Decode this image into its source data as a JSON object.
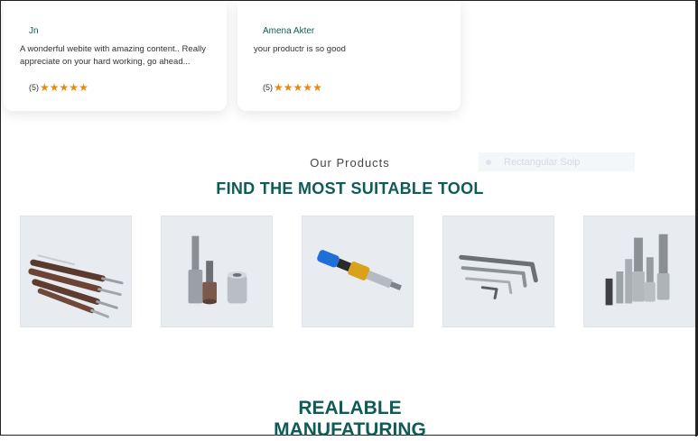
{
  "reviews": [
    {
      "name": "Jn",
      "text": "A wonderful webite with amazing content.. Really appreciate on your hard working, go ahead...",
      "rating": "(5)",
      "stars": 5
    },
    {
      "name": "Amena Akter",
      "text": "your productr is so good",
      "rating": "(5)",
      "stars": 5
    }
  ],
  "products_section": {
    "subtitle": "Our Products",
    "title": "FIND THE MOST SUITABLE TOOL",
    "ghost_tag": "Rectangular Soip"
  },
  "products": [
    {
      "icon": "screwdriver-bits-image"
    },
    {
      "icon": "nut-setter-sockets-image"
    },
    {
      "icon": "quick-release-bit-holder-image"
    },
    {
      "icon": "hex-keys-image"
    },
    {
      "icon": "socket-adapters-image"
    }
  ],
  "next_section": {
    "title_line1": "REALABLE",
    "title_line2": "MANUFATURING"
  },
  "colors": {
    "accent": "#0f5c57",
    "star": "#e68a0c",
    "product_bg": "#e6e9ef"
  }
}
